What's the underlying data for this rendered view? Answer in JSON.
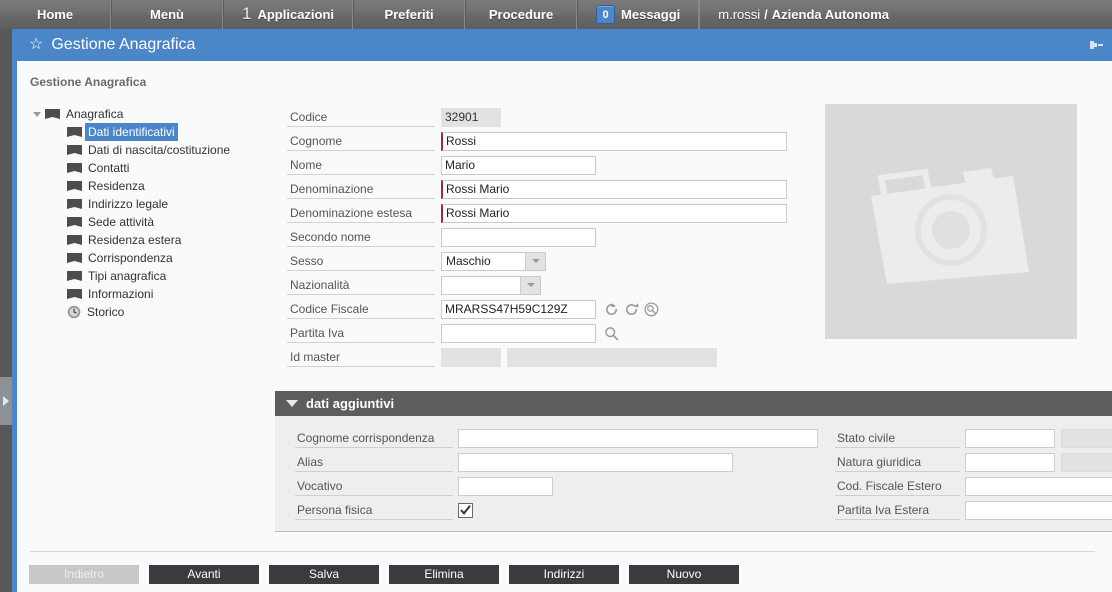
{
  "topnav": {
    "items": [
      {
        "label": "Home",
        "icon": null,
        "badge": null,
        "count": null
      },
      {
        "label": "Menù",
        "icon": null,
        "badge": null,
        "count": null
      },
      {
        "label": "Applicazioni",
        "icon": null,
        "badge": null,
        "count": "1"
      },
      {
        "label": "Preferiti",
        "icon": null,
        "badge": null,
        "count": null
      },
      {
        "label": "Procedure",
        "icon": null,
        "badge": null,
        "count": null
      },
      {
        "label": "Messaggi",
        "icon": null,
        "badge": "0",
        "count": null
      }
    ],
    "user": {
      "name": "m.rossi",
      "separator": "/",
      "organization": "Azienda Autonoma"
    }
  },
  "titlebar": {
    "star_icon": "star-icon",
    "title": "Gestione Anagrafica",
    "pin_icon": "pin-collapse-icon"
  },
  "breadcrumb": "Gestione Anagrafica",
  "tree": {
    "root": {
      "label": "Anagrafica",
      "icon": "folder-icon",
      "expanded": true
    },
    "items": [
      {
        "label": "Dati identificativi",
        "icon": "folder-icon",
        "selected": true
      },
      {
        "label": "Dati di nascita/costituzione",
        "icon": "folder-icon",
        "selected": false
      },
      {
        "label": "Contatti",
        "icon": "folder-icon",
        "selected": false
      },
      {
        "label": "Residenza",
        "icon": "folder-icon",
        "selected": false
      },
      {
        "label": "Indirizzo legale",
        "icon": "folder-icon",
        "selected": false
      },
      {
        "label": "Sede attività",
        "icon": "folder-icon",
        "selected": false
      },
      {
        "label": "Residenza estera",
        "icon": "folder-icon",
        "selected": false
      },
      {
        "label": "Corrispondenza",
        "icon": "folder-icon",
        "selected": false
      },
      {
        "label": "Tipi anagrafica",
        "icon": "folder-icon",
        "selected": false
      },
      {
        "label": "Informazioni",
        "icon": "folder-icon",
        "selected": false
      },
      {
        "label": "Storico",
        "icon": "clock-icon",
        "selected": false
      }
    ]
  },
  "form": {
    "codice": {
      "label": "Codice",
      "value": "32901"
    },
    "cognome": {
      "label": "Cognome",
      "value": "Rossi",
      "placeholder": ""
    },
    "nome": {
      "label": "Nome",
      "value": "Mario",
      "placeholder": ""
    },
    "denominazione": {
      "label": "Denominazione",
      "value": "Rossi Mario",
      "placeholder": ""
    },
    "denominazione_estesa": {
      "label": "Denominazione estesa",
      "value": "Rossi Mario",
      "placeholder": ""
    },
    "secondo_nome": {
      "label": "Secondo nome",
      "value": "",
      "placeholder": ""
    },
    "sesso": {
      "label": "Sesso",
      "value": "Maschio"
    },
    "nazionalita": {
      "label": "Nazionalità",
      "value": ""
    },
    "codice_fiscale": {
      "label": "Codice Fiscale",
      "value": "MRARSS47H59C129Z",
      "placeholder": "",
      "icons": [
        "calculate-cw-icon",
        "calculate-ccw-icon",
        "verify-search-icon"
      ]
    },
    "partita_iva": {
      "label": "Partita Iva",
      "value": "",
      "placeholder": "",
      "icons": [
        "search-icon"
      ]
    },
    "id_master": {
      "label": "Id master",
      "value": "",
      "desc": ""
    }
  },
  "photo": {
    "placeholder_icon": "camera-icon"
  },
  "panel": {
    "title": "dati aggiuntivi",
    "expanded": true,
    "left_fields": [
      {
        "label": "Cognome corrispondenza",
        "value": "",
        "type": "text",
        "width": "pw-360"
      },
      {
        "label": "Alias",
        "value": "",
        "type": "text",
        "width": "pw-275"
      },
      {
        "label": "Vocativo",
        "value": "",
        "type": "text",
        "width": "pw-95"
      },
      {
        "label": "Persona fisica",
        "value": "",
        "type": "checkbox",
        "checked": true
      }
    ],
    "right_fields": [
      {
        "label": "Stato civile",
        "value": "",
        "desc": "",
        "type": "code"
      },
      {
        "label": "Natura giuridica",
        "value": "",
        "desc": "",
        "type": "code"
      },
      {
        "label": "Cod. Fiscale Estero",
        "value": "",
        "type": "text"
      },
      {
        "label": "Partita Iva Estera",
        "value": "",
        "type": "text"
      }
    ]
  },
  "footer": {
    "buttons": [
      {
        "label": "Indietro",
        "disabled": true
      },
      {
        "label": "Avanti",
        "disabled": false
      },
      {
        "label": "Salva",
        "disabled": false
      },
      {
        "label": "Elimina",
        "disabled": false
      },
      {
        "label": "Indirizzi",
        "disabled": false
      },
      {
        "label": "Nuovo",
        "disabled": false
      }
    ]
  },
  "colors": {
    "accent_blue": "#4a86c8",
    "nav_gray": "#6e6e6e",
    "panel_header": "#5d5d5d",
    "button_dark": "#3b3b3f",
    "required_marker": "#9e2c3c"
  }
}
